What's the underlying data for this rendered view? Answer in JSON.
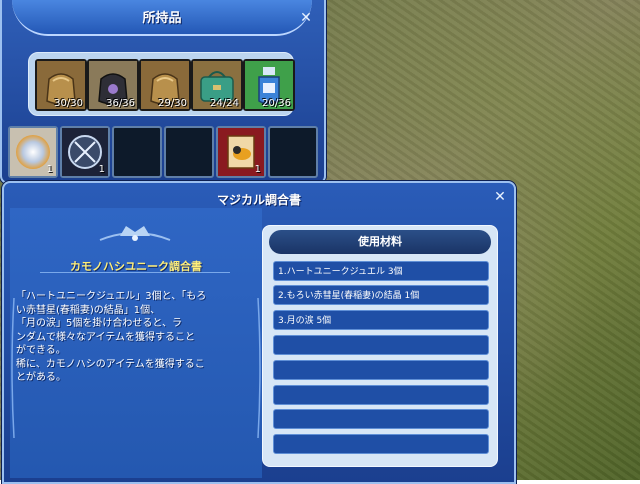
{
  "inventory": {
    "title": "所持品",
    "close_glyph": "✕",
    "bags": [
      {
        "icon": "brown-bag-icon",
        "count": "30/30",
        "color": "#a07838"
      },
      {
        "icon": "black-bag-icon",
        "count": "36/36",
        "color": "#3a3a44"
      },
      {
        "icon": "brown-bag-icon",
        "count": "29/30",
        "color": "#a07838"
      },
      {
        "icon": "green-satchel-icon",
        "count": "24/24",
        "color": "#3a9e86"
      },
      {
        "icon": "blue-bottle-icon",
        "count": "20/36",
        "color": "#3b82d8"
      }
    ],
    "slots": [
      {
        "icon": "glowing-orb-icon",
        "count": "1"
      },
      {
        "icon": "dark-orb-icon",
        "count": "1"
      },
      {
        "icon": "empty",
        "count": ""
      },
      {
        "icon": "empty",
        "count": ""
      },
      {
        "icon": "recipe-scroll-icon",
        "count": "1"
      },
      {
        "icon": "empty",
        "count": ""
      }
    ]
  },
  "recipe": {
    "title": "マジカル調合書",
    "close_glyph": "✕",
    "book_name": "カモノハシユニーク調合書",
    "description": "「ハートユニークジュエル」3個と、「もろ\nい赤彗星(春稲妻)の結晶」1個、\n「月の涙」5個を掛け合わせると、ラ\nンダムで様々なアイテムを獲得すること\nができる。\n稀に、カモノハシのアイテムを獲得するこ\nとがある。",
    "materials_header": "使用材料",
    "materials": [
      "1.ハートユニークジュエル 3個",
      "2.もろい赤彗星(春稲妻)の結晶 1個",
      "3.月の涙 5個",
      "",
      "",
      "",
      "",
      ""
    ]
  }
}
